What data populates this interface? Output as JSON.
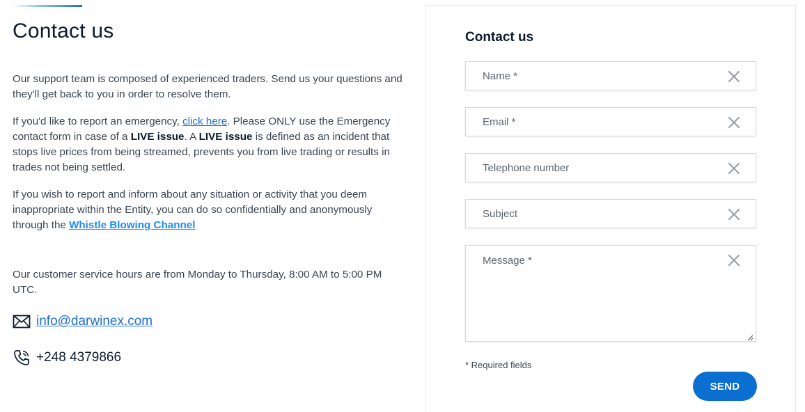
{
  "left": {
    "title": "Contact us",
    "intro": "Our support team is composed of experienced traders. Send us your questions and they'll get back to you in order to resolve them.",
    "emergency": {
      "prefix": "If you'd like to report an emergency, ",
      "link": "click here",
      "middle1": ". Please ONLY use the Emergency contact form in case of a ",
      "bold1": "LIVE issue",
      "middle2": ". A ",
      "bold2": "LIVE issue",
      "suffix": " is defined as an incident that stops live prices from being streamed, prevents you from live trading or results in trades not being settled."
    },
    "whistle": {
      "prefix": "If you wish to report and inform about any situation or activity that you deem inappropriate within the Entity, you can do so confidentially and anonymously through the ",
      "link": "Whistle Blowing Channel"
    },
    "hours": "Our customer service hours are from Monday to Thursday, 8:00 AM to 5:00 PM UTC.",
    "email": "info@darwinex.com",
    "phone": "+248 4379866",
    "icons": {
      "email": "envelope-icon",
      "phone": "phone-icon"
    }
  },
  "form": {
    "title": "Contact us",
    "fields": {
      "name": "Name *",
      "email": "Email *",
      "phone": "Telephone number",
      "subject": "Subject",
      "message": "Message *"
    },
    "required_note": "* Required fields",
    "send_label": "SEND"
  },
  "colors": {
    "accent": "#0a6fd1",
    "link": "#1f6fd0",
    "link_bright": "#1a8cff",
    "text": "#3a4552",
    "heading": "#0d1b2e"
  }
}
